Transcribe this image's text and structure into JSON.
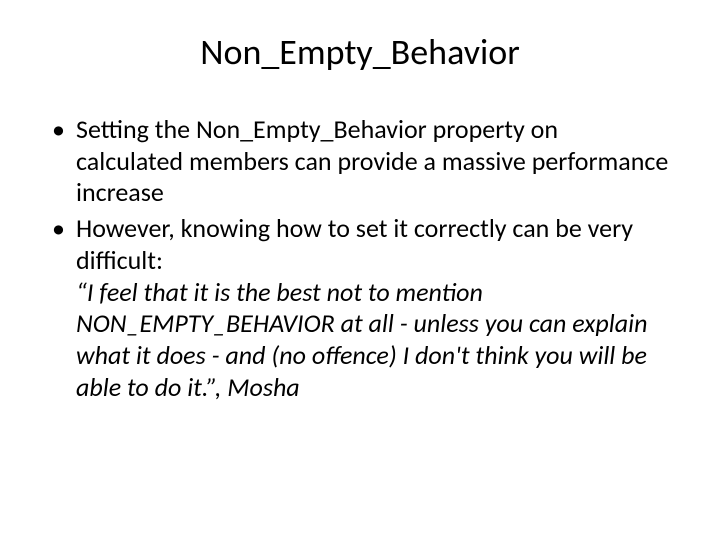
{
  "slide": {
    "title": "Non_Empty_Behavior",
    "bullets": [
      {
        "text": "Setting the Non_Empty_Behavior property on calculated members can provide a massive performance increase"
      },
      {
        "text": "However, knowing how to set it correctly can be very difficult:",
        "quote": "“I feel that it is the best not to mention NON_EMPTY_BEHAVIOR at all - unless you can explain what it does - and (no offence) I don't think you will be able to do it.”, Mosha"
      }
    ]
  }
}
